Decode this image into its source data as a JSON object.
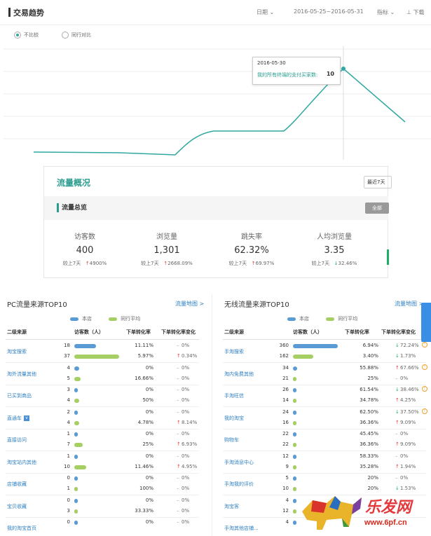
{
  "trend": {
    "title": "交易趋势",
    "date_label": "日期",
    "date_range": "2016-05-25~2016-05-31",
    "metric_label": "指标",
    "download_label": "下载",
    "radio_compare_none": "不比较",
    "radio_compare_peer": "同行对比",
    "tooltip": {
      "date": "2016-05-30",
      "metric": "我的所有终端的支付买家数:",
      "value": "10"
    }
  },
  "overview": {
    "title": "流量概况",
    "period": "最近7天",
    "sub_title": "流量总览",
    "all_button": "全部",
    "metrics": [
      {
        "label": "访客数",
        "value": "400",
        "compare": "较上7天",
        "change": "4900%",
        "dir": "up"
      },
      {
        "label": "浏览量",
        "value": "1,301",
        "compare": "较上7天",
        "change": "2668.09%",
        "dir": "up"
      },
      {
        "label": "跳失率",
        "value": "62.32%",
        "compare": "较上7天",
        "change": "69.97%",
        "dir": "up"
      },
      {
        "label": "人均浏览量",
        "value": "3.35",
        "compare": "较上7天",
        "change": "32.46%",
        "dir": "down"
      }
    ]
  },
  "pc": {
    "title": "PC流量来源TOP10",
    "map_link": "流量地图 >",
    "legend_store": "本店",
    "legend_peer": "同行平均",
    "headers": [
      "二级来源",
      "访客数（人）",
      "下单转化率",
      "下单转化率变化"
    ],
    "rows": [
      {
        "source": "淘宝搜索",
        "tag": false,
        "store": {
          "visitors": "18",
          "rate": "11.11%",
          "change": "0%",
          "dir": "flat"
        },
        "peer": {
          "visitors": "37",
          "rate": "5.97%",
          "change": "0.34%",
          "dir": "up"
        }
      },
      {
        "source": "淘外流量其他",
        "tag": false,
        "store": {
          "visitors": "4",
          "rate": "0%",
          "change": "0%",
          "dir": "flat"
        },
        "peer": {
          "visitors": "5",
          "rate": "16.66%",
          "change": "0%",
          "dir": "flat"
        }
      },
      {
        "source": "已买到商品",
        "tag": false,
        "store": {
          "visitors": "3",
          "rate": "0%",
          "change": "0%",
          "dir": "flat"
        },
        "peer": {
          "visitors": "4",
          "rate": "50%",
          "change": "0%",
          "dir": "flat"
        }
      },
      {
        "source": "直通车",
        "tag": true,
        "store": {
          "visitors": "2",
          "rate": "0%",
          "change": "0%",
          "dir": "flat"
        },
        "peer": {
          "visitors": "4",
          "rate": "4.78%",
          "change": "8.14%",
          "dir": "up"
        }
      },
      {
        "source": "直接访问",
        "tag": false,
        "store": {
          "visitors": "1",
          "rate": "0%",
          "change": "0%",
          "dir": "flat"
        },
        "peer": {
          "visitors": "7",
          "rate": "25%",
          "change": "6.93%",
          "dir": "up"
        }
      },
      {
        "source": "淘宝站内其他",
        "tag": false,
        "store": {
          "visitors": "1",
          "rate": "0%",
          "change": "0%",
          "dir": "flat"
        },
        "peer": {
          "visitors": "10",
          "rate": "11.46%",
          "change": "4.95%",
          "dir": "up"
        }
      },
      {
        "source": "店铺收藏",
        "tag": false,
        "store": {
          "visitors": "0",
          "rate": "0%",
          "change": "0%",
          "dir": "flat"
        },
        "peer": {
          "visitors": "1",
          "rate": "100%",
          "change": "0%",
          "dir": "flat"
        }
      },
      {
        "source": "宝贝收藏",
        "tag": false,
        "store": {
          "visitors": "0",
          "rate": "0%",
          "change": "0%",
          "dir": "flat"
        },
        "peer": {
          "visitors": "3",
          "rate": "33.33%",
          "change": "0%",
          "dir": "flat"
        }
      },
      {
        "source": "我的淘宝首页",
        "tag": false,
        "store": {
          "visitors": "0",
          "rate": "0%",
          "change": "0%",
          "dir": "flat"
        },
        "peer": {
          "visitors": "",
          "rate": "",
          "change": "",
          "dir": "none"
        }
      }
    ]
  },
  "mobile": {
    "title": "无线流量来源TOP10",
    "map_link": "流量地图 >",
    "legend_store": "本店",
    "legend_peer": "同行平均",
    "headers": [
      "二级来源",
      "访客数（人）",
      "下单转化率",
      "下单转化率变化"
    ],
    "rows": [
      {
        "source": "手淘搜索",
        "store": {
          "visitors": "360",
          "rate": "6.94%",
          "change": "72.24%",
          "dir": "down",
          "warn": true
        },
        "peer": {
          "visitors": "162",
          "rate": "3.40%",
          "change": "1.73%",
          "dir": "down",
          "warn": false
        }
      },
      {
        "source": "淘内免费其他",
        "store": {
          "visitors": "34",
          "rate": "55.88%",
          "change": "67.66%",
          "dir": "up",
          "warn": true
        },
        "peer": {
          "visitors": "21",
          "rate": "25%",
          "change": "0%",
          "dir": "flat",
          "warn": false
        }
      },
      {
        "source": "手淘旺信",
        "store": {
          "visitors": "26",
          "rate": "61.54%",
          "change": "38.46%",
          "dir": "down",
          "warn": true
        },
        "peer": {
          "visitors": "14",
          "rate": "34.78%",
          "change": "4.25%",
          "dir": "up",
          "warn": false
        }
      },
      {
        "source": "我的淘宝",
        "store": {
          "visitors": "24",
          "rate": "62.50%",
          "change": "37.50%",
          "dir": "down",
          "warn": true
        },
        "peer": {
          "visitors": "16",
          "rate": "36.36%",
          "change": "9.09%",
          "dir": "up",
          "warn": false
        }
      },
      {
        "source": "购物车",
        "store": {
          "visitors": "22",
          "rate": "45.45%",
          "change": "0%",
          "dir": "flat",
          "warn": false
        },
        "peer": {
          "visitors": "22",
          "rate": "36.36%",
          "change": "9.09%",
          "dir": "up",
          "warn": false
        }
      },
      {
        "source": "手淘消息中心",
        "store": {
          "visitors": "12",
          "rate": "58.33%",
          "change": "0%",
          "dir": "flat",
          "warn": false
        },
        "peer": {
          "visitors": "9",
          "rate": "35.28%",
          "change": "1.94%",
          "dir": "up",
          "warn": false
        }
      },
      {
        "source": "手淘我的评价",
        "store": {
          "visitors": "5",
          "rate": "20%",
          "change": "0%",
          "dir": "flat",
          "warn": false
        },
        "peer": {
          "visitors": "10",
          "rate": "20%",
          "change": "1.53%",
          "dir": "down",
          "warn": false
        }
      },
      {
        "source": "淘宝客",
        "store": {
          "visitors": "4",
          "rate": "",
          "change": "",
          "dir": "none",
          "warn": false
        },
        "peer": {
          "visitors": "12",
          "rate": "",
          "change": "",
          "dir": "none",
          "warn": false
        }
      },
      {
        "source": "手淘其他店铺...",
        "store": {
          "visitors": "4",
          "rate": "",
          "change": "",
          "dir": "none",
          "warn": false
        },
        "peer": {
          "visitors": "",
          "rate": "",
          "change": "",
          "dir": "none",
          "warn": false
        }
      }
    ]
  },
  "watermark": {
    "brand": "乐发网",
    "url": "www.6pf.cn"
  },
  "colors": {
    "accent": "#2a9d8f",
    "store_bar": "#5b9bd5",
    "peer_bar": "#a5cf63",
    "up": "#e4393c",
    "down": "#1aaf62",
    "link": "#2e7fc1"
  }
}
